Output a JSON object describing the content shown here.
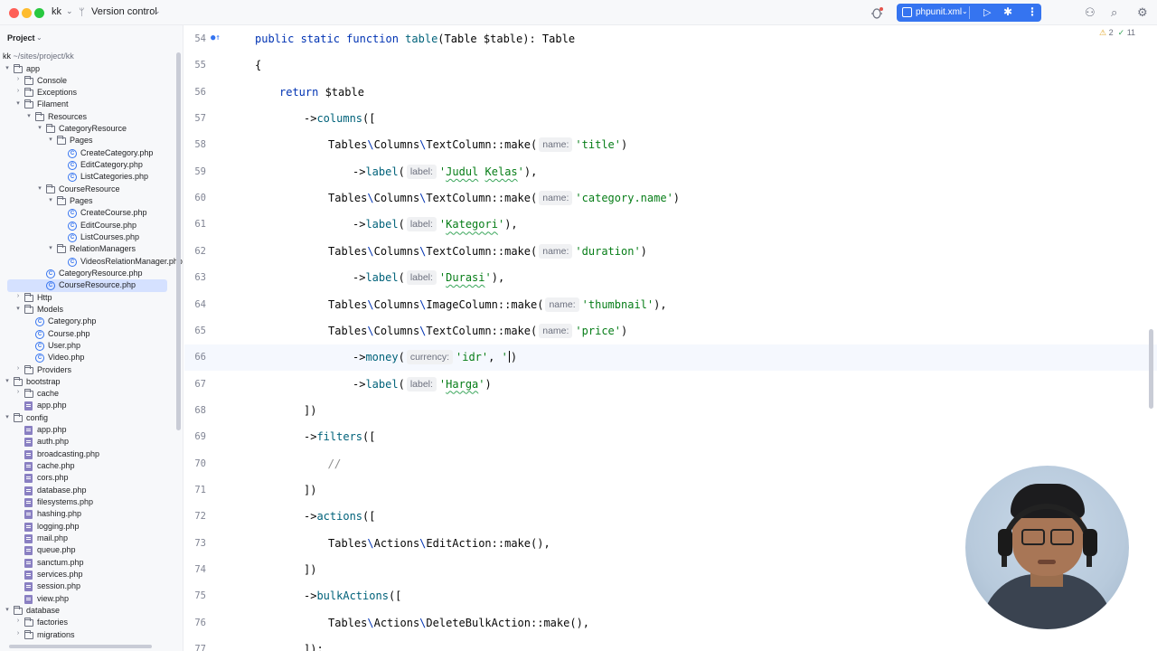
{
  "titlebar": {
    "project_name": "kk",
    "vcs_label": "Version control",
    "run_config": "phpunit.xml"
  },
  "sidebar": {
    "title": "Project",
    "root_name": "kk",
    "root_path": "~/sites/project/kk",
    "items": [
      {
        "label": "app",
        "depth": 0,
        "type": "folder",
        "expanded": true
      },
      {
        "label": "Console",
        "depth": 1,
        "type": "folder",
        "expanded": false
      },
      {
        "label": "Exceptions",
        "depth": 1,
        "type": "folder",
        "expanded": false
      },
      {
        "label": "Filament",
        "depth": 1,
        "type": "folder",
        "expanded": true
      },
      {
        "label": "Resources",
        "depth": 2,
        "type": "folder",
        "expanded": true
      },
      {
        "label": "CategoryResource",
        "depth": 3,
        "type": "folder",
        "expanded": true
      },
      {
        "label": "Pages",
        "depth": 4,
        "type": "folder",
        "expanded": true
      },
      {
        "label": "CreateCategory.php",
        "depth": 5,
        "type": "class"
      },
      {
        "label": "EditCategory.php",
        "depth": 5,
        "type": "class"
      },
      {
        "label": "ListCategories.php",
        "depth": 5,
        "type": "class"
      },
      {
        "label": "CourseResource",
        "depth": 3,
        "type": "folder",
        "expanded": true
      },
      {
        "label": "Pages",
        "depth": 4,
        "type": "folder",
        "expanded": true
      },
      {
        "label": "CreateCourse.php",
        "depth": 5,
        "type": "class"
      },
      {
        "label": "EditCourse.php",
        "depth": 5,
        "type": "class"
      },
      {
        "label": "ListCourses.php",
        "depth": 5,
        "type": "class"
      },
      {
        "label": "RelationManagers",
        "depth": 4,
        "type": "folder",
        "expanded": true
      },
      {
        "label": "VideosRelationManager.php",
        "depth": 5,
        "type": "class"
      },
      {
        "label": "CategoryResource.php",
        "depth": 3,
        "type": "class"
      },
      {
        "label": "CourseResource.php",
        "depth": 3,
        "type": "class",
        "selected": true
      },
      {
        "label": "Http",
        "depth": 1,
        "type": "folder",
        "expanded": false
      },
      {
        "label": "Models",
        "depth": 1,
        "type": "folder",
        "expanded": true
      },
      {
        "label": "Category.php",
        "depth": 2,
        "type": "class"
      },
      {
        "label": "Course.php",
        "depth": 2,
        "type": "class"
      },
      {
        "label": "User.php",
        "depth": 2,
        "type": "class"
      },
      {
        "label": "Video.php",
        "depth": 2,
        "type": "class"
      },
      {
        "label": "Providers",
        "depth": 1,
        "type": "folder",
        "expanded": false
      },
      {
        "label": "bootstrap",
        "depth": 0,
        "type": "folder",
        "expanded": true
      },
      {
        "label": "cache",
        "depth": 1,
        "type": "folder",
        "expanded": false
      },
      {
        "label": "app.php",
        "depth": 1,
        "type": "php"
      },
      {
        "label": "config",
        "depth": 0,
        "type": "folder",
        "expanded": true
      },
      {
        "label": "app.php",
        "depth": 1,
        "type": "php"
      },
      {
        "label": "auth.php",
        "depth": 1,
        "type": "php"
      },
      {
        "label": "broadcasting.php",
        "depth": 1,
        "type": "php"
      },
      {
        "label": "cache.php",
        "depth": 1,
        "type": "php"
      },
      {
        "label": "cors.php",
        "depth": 1,
        "type": "php"
      },
      {
        "label": "database.php",
        "depth": 1,
        "type": "php"
      },
      {
        "label": "filesystems.php",
        "depth": 1,
        "type": "php"
      },
      {
        "label": "hashing.php",
        "depth": 1,
        "type": "php"
      },
      {
        "label": "logging.php",
        "depth": 1,
        "type": "php"
      },
      {
        "label": "mail.php",
        "depth": 1,
        "type": "php"
      },
      {
        "label": "queue.php",
        "depth": 1,
        "type": "php"
      },
      {
        "label": "sanctum.php",
        "depth": 1,
        "type": "php"
      },
      {
        "label": "services.php",
        "depth": 1,
        "type": "php"
      },
      {
        "label": "session.php",
        "depth": 1,
        "type": "php"
      },
      {
        "label": "view.php",
        "depth": 1,
        "type": "php"
      },
      {
        "label": "database",
        "depth": 0,
        "type": "folder",
        "expanded": true
      },
      {
        "label": "factories",
        "depth": 1,
        "type": "folder",
        "expanded": false
      },
      {
        "label": "migrations",
        "depth": 1,
        "type": "folder",
        "expanded": false
      }
    ]
  },
  "editor": {
    "inspections": {
      "warnings": "2",
      "ok": "11"
    },
    "current_line": 66,
    "lines": [
      {
        "n": "54",
        "icon": "●↑",
        "tokens": [
          [
            "kw",
            "public static function "
          ],
          [
            "fn",
            "table"
          ],
          [
            "p",
            "("
          ],
          [
            "ty",
            "Table "
          ],
          [
            "p",
            "$table): "
          ],
          [
            "ty",
            "Table"
          ]
        ]
      },
      {
        "n": "55",
        "tokens": [
          [
            "p",
            "{"
          ]
        ]
      },
      {
        "n": "56",
        "indent": 1,
        "tokens": [
          [
            "kw",
            "return "
          ],
          [
            "p",
            "$table"
          ]
        ]
      },
      {
        "n": "57",
        "indent": 2,
        "tokens": [
          [
            "p",
            "->"
          ],
          [
            "mth",
            "columns"
          ],
          [
            "p",
            "(["
          ]
        ]
      },
      {
        "n": "58",
        "indent": 3,
        "tokens": [
          [
            "ns",
            "Tables"
          ],
          [
            "sep",
            "\\"
          ],
          [
            "ns",
            "Columns"
          ],
          [
            "sep",
            "\\"
          ],
          [
            "ns",
            "TextColumn"
          ],
          [
            "p",
            "::make("
          ],
          [
            "hint",
            "name:"
          ],
          [
            "str",
            "'title'"
          ],
          [
            "p",
            ")"
          ]
        ]
      },
      {
        "n": "59",
        "indent": 4,
        "tokens": [
          [
            "p",
            "->"
          ],
          [
            "mth",
            "label"
          ],
          [
            "p",
            "("
          ],
          [
            "hint",
            "label:"
          ],
          [
            "str",
            "'"
          ],
          [
            "typo",
            "Judul"
          ],
          [
            "str",
            " "
          ],
          [
            "typo",
            "Kelas"
          ],
          [
            "str",
            "'"
          ],
          [
            "p",
            "),"
          ]
        ]
      },
      {
        "n": "60",
        "indent": 3,
        "tokens": [
          [
            "ns",
            "Tables"
          ],
          [
            "sep",
            "\\"
          ],
          [
            "ns",
            "Columns"
          ],
          [
            "sep",
            "\\"
          ],
          [
            "ns",
            "TextColumn"
          ],
          [
            "p",
            "::make("
          ],
          [
            "hint",
            "name:"
          ],
          [
            "str",
            "'category.name'"
          ],
          [
            "p",
            ")"
          ]
        ]
      },
      {
        "n": "61",
        "indent": 4,
        "tokens": [
          [
            "p",
            "->"
          ],
          [
            "mth",
            "label"
          ],
          [
            "p",
            "("
          ],
          [
            "hint",
            "label:"
          ],
          [
            "str",
            "'"
          ],
          [
            "typo",
            "Kategori"
          ],
          [
            "str",
            "'"
          ],
          [
            "p",
            "),"
          ]
        ]
      },
      {
        "n": "62",
        "indent": 3,
        "tokens": [
          [
            "ns",
            "Tables"
          ],
          [
            "sep",
            "\\"
          ],
          [
            "ns",
            "Columns"
          ],
          [
            "sep",
            "\\"
          ],
          [
            "ns",
            "TextColumn"
          ],
          [
            "p",
            "::make("
          ],
          [
            "hint",
            "name:"
          ],
          [
            "str",
            "'duration'"
          ],
          [
            "p",
            ")"
          ]
        ]
      },
      {
        "n": "63",
        "indent": 4,
        "tokens": [
          [
            "p",
            "->"
          ],
          [
            "mth",
            "label"
          ],
          [
            "p",
            "("
          ],
          [
            "hint",
            "label:"
          ],
          [
            "str",
            "'"
          ],
          [
            "typo",
            "Durasi"
          ],
          [
            "str",
            "'"
          ],
          [
            "p",
            "),"
          ]
        ]
      },
      {
        "n": "64",
        "indent": 3,
        "tokens": [
          [
            "ns",
            "Tables"
          ],
          [
            "sep",
            "\\"
          ],
          [
            "ns",
            "Columns"
          ],
          [
            "sep",
            "\\"
          ],
          [
            "ns",
            "ImageColumn"
          ],
          [
            "p",
            "::make("
          ],
          [
            "hint",
            "name:"
          ],
          [
            "str",
            "'thumbnail'"
          ],
          [
            "p",
            "),"
          ]
        ]
      },
      {
        "n": "65",
        "indent": 3,
        "tokens": [
          [
            "ns",
            "Tables"
          ],
          [
            "sep",
            "\\"
          ],
          [
            "ns",
            "Columns"
          ],
          [
            "sep",
            "\\"
          ],
          [
            "ns",
            "TextColumn"
          ],
          [
            "p",
            "::make("
          ],
          [
            "hint",
            "name:"
          ],
          [
            "str",
            "'price'"
          ],
          [
            "p",
            ")"
          ]
        ]
      },
      {
        "n": "66",
        "indent": 4,
        "tokens": [
          [
            "p",
            "->"
          ],
          [
            "mth",
            "money"
          ],
          [
            "p",
            "("
          ],
          [
            "hint",
            "currency:"
          ],
          [
            "str",
            "'idr'"
          ],
          [
            "p",
            ", "
          ],
          [
            "str",
            "'"
          ],
          [
            "caret",
            ""
          ],
          [
            "p",
            ")"
          ]
        ]
      },
      {
        "n": "67",
        "indent": 4,
        "tokens": [
          [
            "p",
            "->"
          ],
          [
            "mth",
            "label"
          ],
          [
            "p",
            "("
          ],
          [
            "hint",
            "label:"
          ],
          [
            "str",
            "'"
          ],
          [
            "typo",
            "Harga"
          ],
          [
            "str",
            "'"
          ],
          [
            "p",
            ")"
          ]
        ]
      },
      {
        "n": "68",
        "indent": 2,
        "tokens": [
          [
            "p",
            "])"
          ]
        ]
      },
      {
        "n": "69",
        "indent": 2,
        "tokens": [
          [
            "p",
            "->"
          ],
          [
            "mth",
            "filters"
          ],
          [
            "p",
            "(["
          ]
        ]
      },
      {
        "n": "70",
        "indent": 3,
        "tokens": [
          [
            "cmt",
            "//"
          ]
        ]
      },
      {
        "n": "71",
        "indent": 2,
        "tokens": [
          [
            "p",
            "])"
          ]
        ]
      },
      {
        "n": "72",
        "indent": 2,
        "tokens": [
          [
            "p",
            "->"
          ],
          [
            "mth",
            "actions"
          ],
          [
            "p",
            "(["
          ]
        ]
      },
      {
        "n": "73",
        "indent": 3,
        "tokens": [
          [
            "ns",
            "Tables"
          ],
          [
            "sep",
            "\\"
          ],
          [
            "ns",
            "Actions"
          ],
          [
            "sep",
            "\\"
          ],
          [
            "ns",
            "EditAction"
          ],
          [
            "p",
            "::make(),"
          ]
        ]
      },
      {
        "n": "74",
        "indent": 2,
        "tokens": [
          [
            "p",
            "])"
          ]
        ]
      },
      {
        "n": "75",
        "indent": 2,
        "tokens": [
          [
            "p",
            "->"
          ],
          [
            "mth",
            "bulkActions"
          ],
          [
            "p",
            "(["
          ]
        ]
      },
      {
        "n": "76",
        "indent": 3,
        "tokens": [
          [
            "ns",
            "Tables"
          ],
          [
            "sep",
            "\\"
          ],
          [
            "ns",
            "Actions"
          ],
          [
            "sep",
            "\\"
          ],
          [
            "ns",
            "DeleteBulkAction"
          ],
          [
            "p",
            "::make(),"
          ]
        ]
      },
      {
        "n": "77",
        "indent": 2,
        "tokens": [
          [
            "p",
            "]);"
          ]
        ]
      }
    ]
  },
  "colors": {
    "accent": "#3574f0",
    "selection": "#d5e1ff",
    "keyword": "#0033b3",
    "string": "#067d17",
    "method": "#00627a"
  },
  "icons": [
    "chevron-down-icon",
    "branch-icon",
    "bug-icon",
    "run-icon",
    "debug-icon",
    "more-icon",
    "profile-icon",
    "search-icon",
    "settings-icon"
  ]
}
